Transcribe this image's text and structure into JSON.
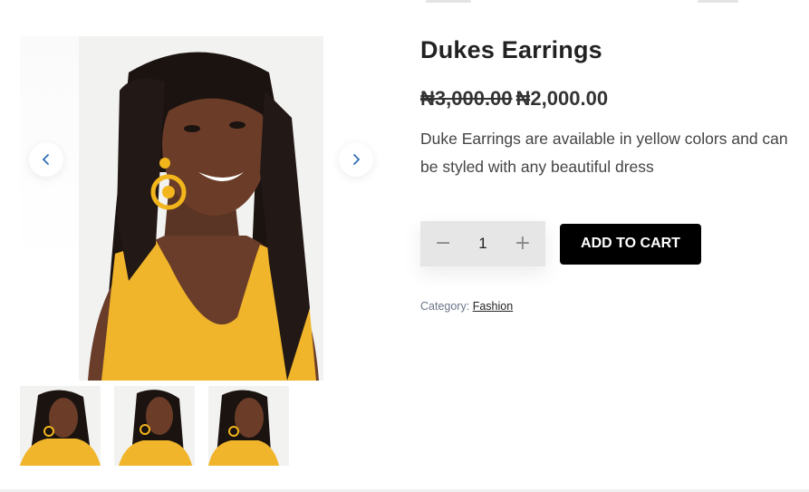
{
  "product": {
    "title": "Dukes Earrings",
    "price_old": "₦3,000.00",
    "price_new": "₦2,000.00",
    "description": "Duke Earrings are available in yellow colors and can be styled with any beautiful dress",
    "quantity": "1",
    "add_to_cart_label": "ADD TO CART",
    "category_label": "Category:",
    "category_value": "Fashion"
  },
  "gallery": {
    "thumbnail_count": 3,
    "active_thumbnail": 1
  },
  "colors": {
    "accent_arrow": "#2f6fb3",
    "button_bg": "#000000",
    "qty_bg": "#e6e6e6",
    "top_yellow": "#f3b51c"
  },
  "icons": {
    "prev": "chevron-left-icon",
    "next": "chevron-right-icon",
    "minus": "minus-icon",
    "plus": "plus-icon"
  }
}
